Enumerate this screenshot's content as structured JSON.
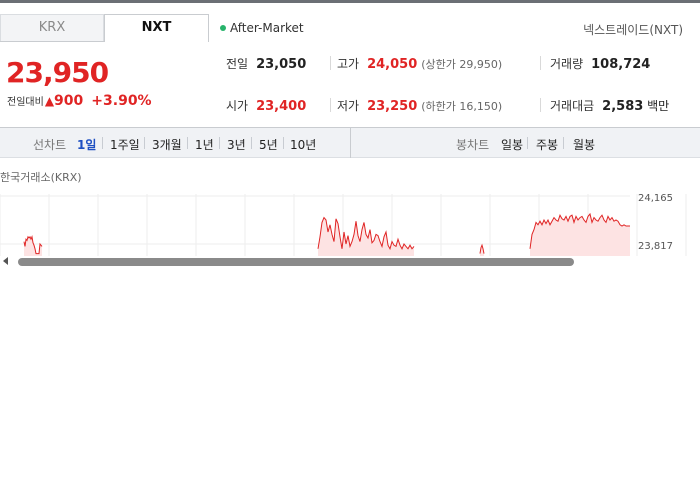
{
  "tabs": [
    {
      "label": "KRX",
      "active": false
    },
    {
      "label": "NXT",
      "active": true
    }
  ],
  "session_label": "After-Market",
  "venue_name": "넥스트레이드(NXT)",
  "quote": {
    "price": "23,950",
    "change_label": "전일대비",
    "change_arrow": "▲",
    "change_amount": "900",
    "change_percent": "+3.90%",
    "up_color": "#e02424"
  },
  "stats": {
    "prev_close": {
      "label": "전일",
      "value": "23,050"
    },
    "high": {
      "label": "고가",
      "value": "24,050",
      "sub": "(상한가 29,950)"
    },
    "volume": {
      "label": "거래량",
      "value": "108,724"
    },
    "open": {
      "label": "시가",
      "value": "23,400"
    },
    "low": {
      "label": "저가",
      "value": "23,250",
      "sub": "(하한가 16,150)"
    },
    "trade_value": {
      "label": "거래대금",
      "value": "2,583",
      "unit": "백만"
    }
  },
  "chart_controls": {
    "line_label": "선차트",
    "line_periods": [
      "1일",
      "1주일",
      "3개월",
      "1년",
      "3년",
      "5년",
      "10년"
    ],
    "active_period": "1일",
    "candle_label": "봉차트",
    "candle_periods": [
      "일봉",
      "주봉",
      "월봉"
    ]
  },
  "exchange_label": "한국거래소(KRX)",
  "chart_data": {
    "type": "area",
    "y_ticks": [
      "24,165",
      "23,817"
    ],
    "ylim": [
      23700,
      24200
    ],
    "color": "#e02424",
    "fill": "#fde3e3",
    "segments": [
      {
        "x": [
          24,
          25,
          26,
          27,
          28,
          29,
          30,
          31,
          32,
          33,
          34,
          35,
          36,
          37,
          38,
          39,
          40,
          41,
          42
        ],
        "y": [
          23820,
          23780,
          23840,
          23830,
          23860,
          23850,
          23860,
          23840,
          23860,
          23810,
          23790,
          23760,
          23720,
          23720,
          23720,
          23720,
          23800,
          23790,
          23780
        ]
      },
      {
        "x": [
          318,
          320,
          322,
          324,
          326,
          328,
          330,
          332,
          334,
          336,
          338,
          340,
          342,
          344,
          346,
          348,
          350,
          352,
          354,
          356,
          358,
          360,
          362,
          364,
          366,
          368,
          370,
          372,
          374,
          376,
          378,
          380,
          382,
          384,
          386,
          388,
          390,
          392,
          394,
          396,
          398,
          400,
          402,
          404,
          406,
          408,
          410,
          412,
          414
        ],
        "y": [
          23760,
          23860,
          23980,
          24020,
          24000,
          23900,
          23960,
          23880,
          23820,
          24010,
          23970,
          23860,
          23760,
          23900,
          23800,
          23870,
          23780,
          23820,
          23880,
          23990,
          23870,
          23820,
          23920,
          23980,
          23880,
          23850,
          23920,
          23810,
          23830,
          23880,
          23870,
          23820,
          23780,
          23860,
          23900,
          23790,
          23760,
          23820,
          23790,
          23780,
          23840,
          23790,
          23760,
          23800,
          23780,
          23760,
          23790,
          23760,
          23780
        ]
      },
      {
        "x": [
          480,
          481,
          482,
          483,
          484
        ],
        "y": [
          23720,
          23770,
          23790,
          23760,
          23720
        ]
      },
      {
        "x": [
          530,
          532,
          534,
          536,
          538,
          540,
          542,
          544,
          546,
          548,
          550,
          552,
          554,
          556,
          558,
          560,
          562,
          564,
          566,
          568,
          570,
          572,
          574,
          576,
          578,
          580,
          582,
          584,
          586,
          588,
          590,
          592,
          594,
          596,
          598,
          600,
          602,
          604,
          606,
          608,
          610,
          612,
          614,
          616,
          618,
          620,
          622,
          624,
          626,
          628,
          630
        ],
        "y": [
          23760,
          23880,
          23920,
          23980,
          23960,
          23990,
          23960,
          24000,
          23970,
          24000,
          23960,
          23990,
          24020,
          24000,
          23990,
          24040,
          24010,
          24000,
          24030,
          23990,
          24030,
          24040,
          23980,
          24030,
          24000,
          24020,
          24030,
          24000,
          23980,
          24030,
          24050,
          23980,
          24020,
          24000,
          23990,
          24020,
          24040,
          24000,
          23980,
          24030,
          24000,
          24020,
          23990,
          24000,
          23990,
          23960,
          23950,
          23960,
          23950,
          23950,
          23950
        ]
      }
    ]
  }
}
